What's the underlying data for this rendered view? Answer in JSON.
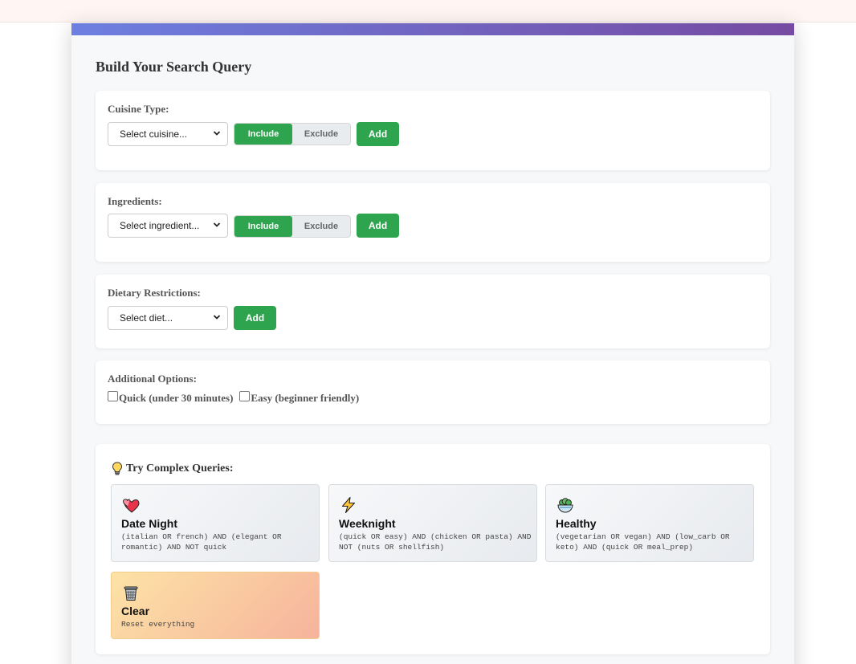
{
  "header": {
    "section_title": "Build Your Search Query"
  },
  "cuisine": {
    "label": "Cuisine Type:",
    "select_value": "Select cuisine...",
    "include_label": "Include",
    "exclude_label": "Exclude",
    "mode": "include",
    "add_label": "Add"
  },
  "ingredients": {
    "label": "Ingredients:",
    "select_value": "Select ingredient...",
    "include_label": "Include",
    "exclude_label": "Exclude",
    "mode": "include",
    "add_label": "Add"
  },
  "dietary": {
    "label": "Dietary Restrictions:",
    "select_value": "Select diet...",
    "add_label": "Add"
  },
  "options": {
    "label": "Additional Options:",
    "quick_label": "Quick (under 30 minutes)",
    "quick_checked": false,
    "easy_label": "Easy (beginner friendly)",
    "easy_checked": false
  },
  "examples": {
    "title": "Try Complex Queries:",
    "title_icon": "lightbulb-icon",
    "items": [
      {
        "icon": "hearts-icon",
        "name": "Date Night",
        "query": "(italian OR french) AND (elegant OR romantic) AND NOT quick"
      },
      {
        "icon": "lightning-icon",
        "name": "Weeknight",
        "query": "(quick OR easy) AND (chicken OR pasta) AND NOT (nuts OR shellfish)"
      },
      {
        "icon": "salad-icon",
        "name": "Healthy",
        "query": "(vegetarian OR vegan) AND (low_carb OR keto) AND (quick OR meal_prep)"
      },
      {
        "icon": "trash-icon",
        "name": "Clear",
        "query": "Reset everything"
      }
    ]
  },
  "colors": {
    "accent_green": "#2ea44f",
    "gradient_start": "#6d7fe0",
    "gradient_end": "#764ba2"
  }
}
